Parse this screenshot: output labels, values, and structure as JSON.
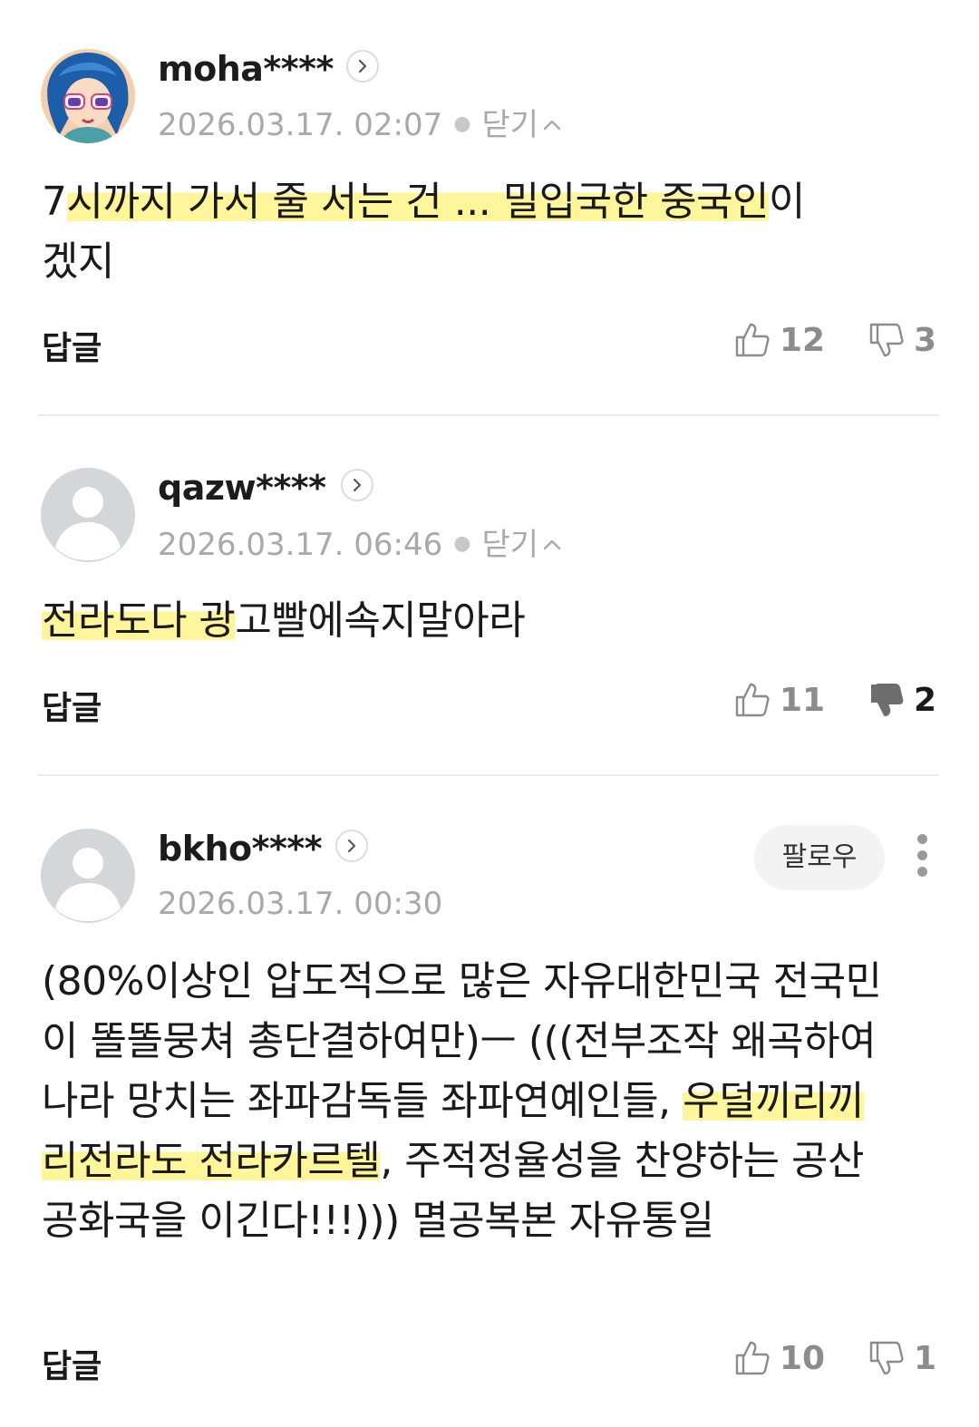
{
  "comments": [
    {
      "username": "moha****",
      "timestamp": "2026.03.17. 02:07",
      "collapse_label": "닫기",
      "text_parts": [
        "7",
        "시까지 가서 줄 서는 건 ... 밀입국한 중국인",
        "이",
        "겠지"
      ],
      "reply_label": "답글",
      "likes": "12",
      "dislikes": "3",
      "avatar": "custom-character",
      "disliked": false
    },
    {
      "username": "qazw****",
      "timestamp": "2026.03.17. 06:46",
      "collapse_label": "닫기",
      "text_parts": [
        "전라도다 광",
        "고빨에속지말아라"
      ],
      "reply_label": "답글",
      "likes": "11",
      "dislikes": "2",
      "avatar": "default-user",
      "disliked": true
    },
    {
      "username": "bkho****",
      "timestamp": "2026.03.17. 00:30",
      "follow_label": "팔로우",
      "text_parts": [
        "(80%이상인 압도적으로 많은 자유대한민국 전국민이 똘똘뭉쳐 총단결하여만)ㅡ (((전부조작 왜곡하여 나라 망치는 좌파감독들 좌파연예인들, ",
        "우덜끼리끼리전라도 전라카르텔",
        ", 주적정율성을 찬양하는 공산공화국을 이긴다!!!))) 멸공복본 자유통일"
      ],
      "reply_label": "답글",
      "likes": "10",
      "dislikes": "1",
      "avatar": "default-user",
      "disliked": false
    }
  ],
  "colors": {
    "highlight": "#fff59a",
    "meta_gray": "#a9a9a9",
    "vote_gray": "#8c8c8c",
    "divider": "#ebebeb"
  },
  "icons": [
    "chevron-right-icon",
    "chevron-up-icon",
    "thumbs-up-icon",
    "thumbs-down-icon",
    "more-vertical-icon"
  ]
}
